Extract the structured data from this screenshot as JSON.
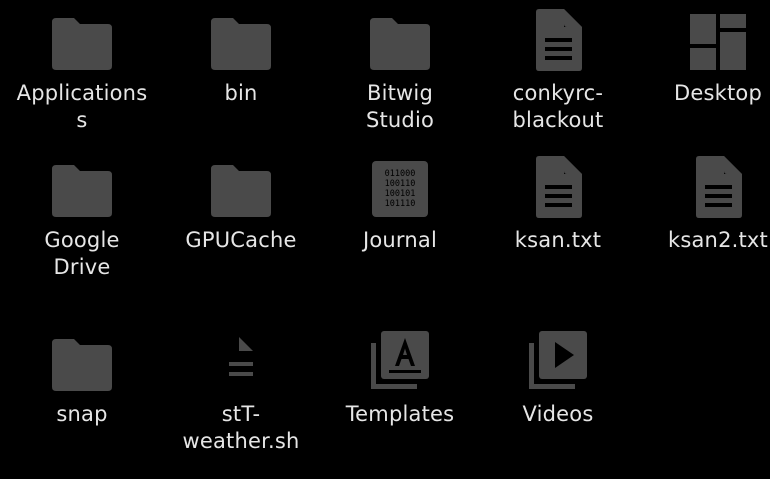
{
  "icon_color": "#4a4a4a",
  "text_color": "#e6e6e6",
  "background": "#000000",
  "files": [
    {
      "name": "Applications\ns",
      "icon": "folder-icon"
    },
    {
      "name": "bin",
      "icon": "folder-icon"
    },
    {
      "name": "Bitwig\nStudio",
      "icon": "folder-icon"
    },
    {
      "name": "conkyrc-\nblackout",
      "icon": "text-document-icon"
    },
    {
      "name": "Desktop",
      "icon": "desktop-folder-icon"
    },
    {
      "name": "Google\nDrive",
      "icon": "folder-icon"
    },
    {
      "name": "GPUCache",
      "icon": "folder-icon"
    },
    {
      "name": "Journal",
      "icon": "binary-file-icon"
    },
    {
      "name": "ksan.txt",
      "icon": "text-document-icon"
    },
    {
      "name": "ksan2.txt",
      "icon": "text-document-icon"
    },
    {
      "name": "snap",
      "icon": "folder-icon"
    },
    {
      "name": "stT-\nweather.sh",
      "icon": "script-file-icon"
    },
    {
      "name": "Templates",
      "icon": "templates-folder-icon"
    },
    {
      "name": "Videos",
      "icon": "videos-folder-icon"
    }
  ],
  "binary_glyph_rows": [
    "011000",
    "100110",
    "100101",
    "101110"
  ]
}
